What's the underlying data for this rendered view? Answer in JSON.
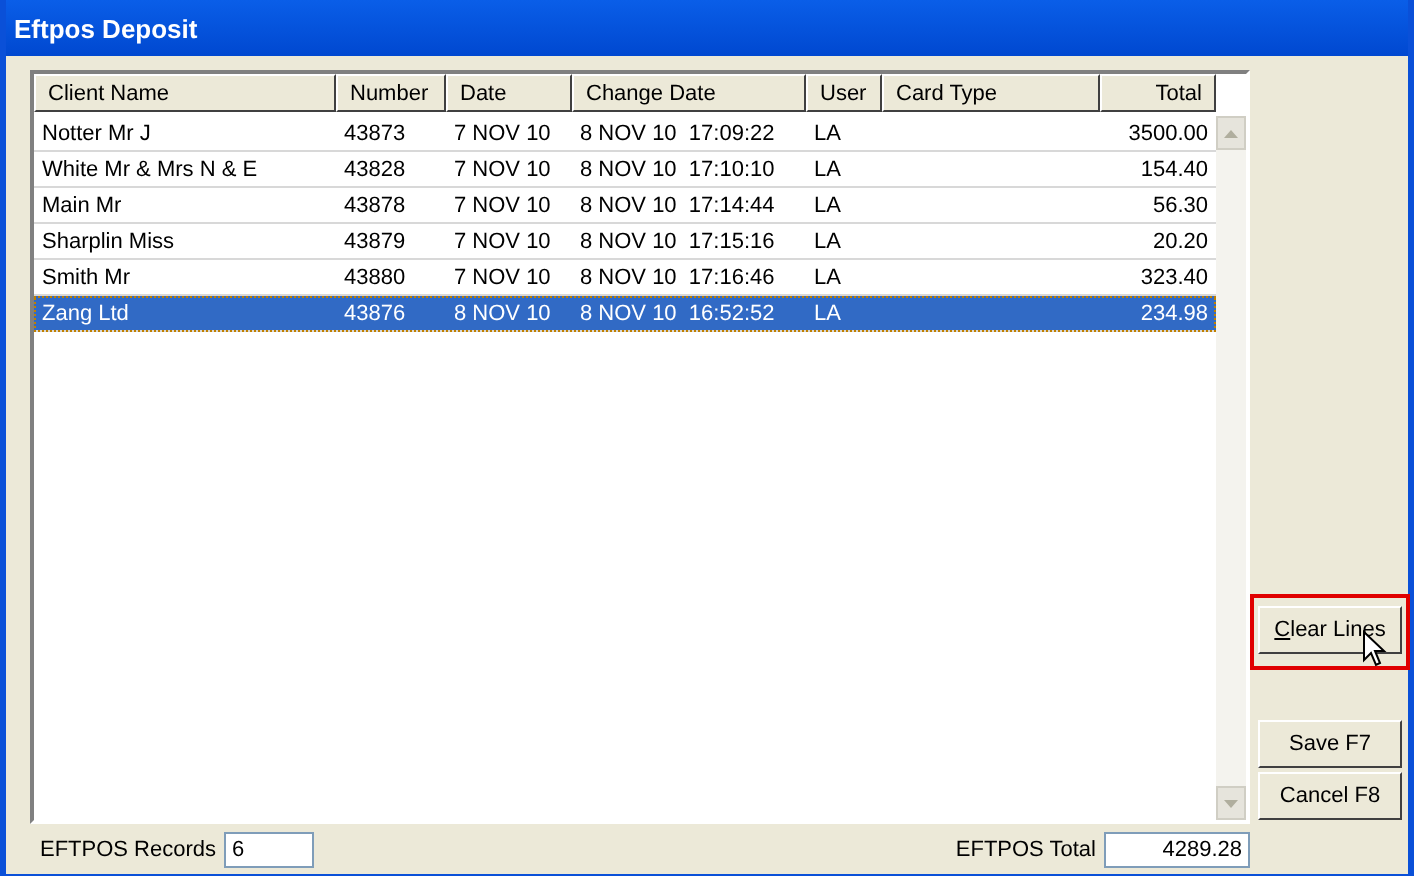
{
  "window": {
    "title": "Eftpos Deposit"
  },
  "table": {
    "columns": [
      "Client Name",
      "Number",
      "Date",
      "Change Date",
      "User",
      "Card Type",
      "Total"
    ],
    "rows": [
      {
        "cells": [
          "Notter Mr J",
          "43873",
          "7 NOV 10",
          "8 NOV 10  17:09:22",
          "LA",
          "",
          "3500.00"
        ],
        "selected": false
      },
      {
        "cells": [
          "White Mr & Mrs N & E",
          "43828",
          "7 NOV 10",
          "8 NOV 10  17:10:10",
          "LA",
          "",
          "154.40"
        ],
        "selected": false
      },
      {
        "cells": [
          "Main Mr",
          "43878",
          "7 NOV 10",
          "8 NOV 10  17:14:44",
          "LA",
          "",
          "56.30"
        ],
        "selected": false
      },
      {
        "cells": [
          "Sharplin Miss",
          "43879",
          "7 NOV 10",
          "8 NOV 10  17:15:16",
          "LA",
          "",
          "20.20"
        ],
        "selected": false
      },
      {
        "cells": [
          "Smith Mr",
          "43880",
          "7 NOV 10",
          "8 NOV 10  17:16:46",
          "LA",
          "",
          "323.40"
        ],
        "selected": false
      },
      {
        "cells": [
          "Zang Ltd",
          "43876",
          "8 NOV 10",
          "8 NOV 10  16:52:52",
          "LA",
          "",
          "234.98"
        ],
        "selected": true
      }
    ]
  },
  "buttons": [
    {
      "label": "Clear Lines",
      "highlighted": true
    },
    {
      "label": "Save F7",
      "highlighted": false
    },
    {
      "label": "Cancel F8",
      "highlighted": false
    }
  ],
  "footer": {
    "records_label": "EFTPOS Records",
    "records_value": "6",
    "total_label": "EFTPOS Total",
    "total_value": "4289.28"
  }
}
